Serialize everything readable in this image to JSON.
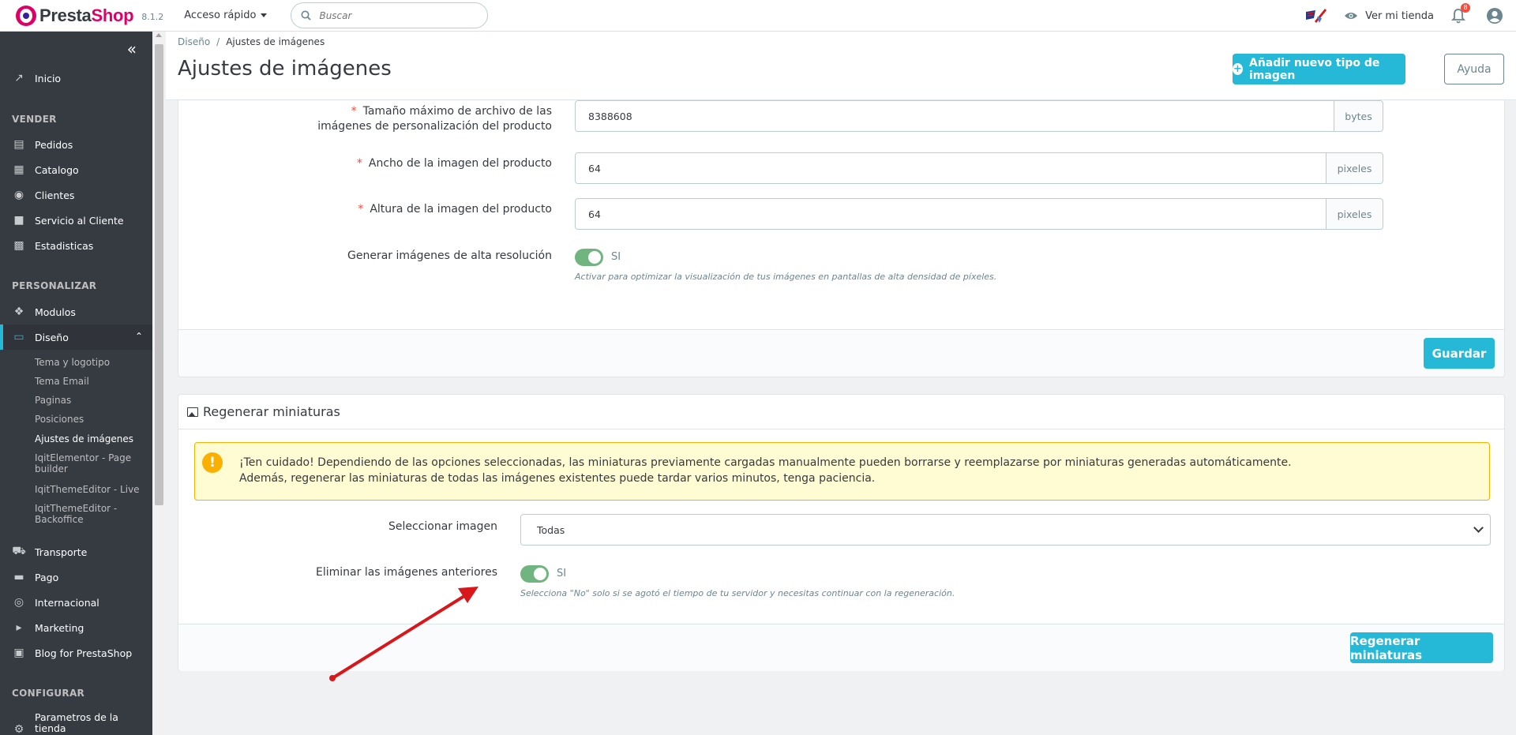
{
  "header": {
    "brand_part1": "Presta",
    "brand_part2": "Shop",
    "version": "8.1.2",
    "quick_access": "Acceso rápido",
    "search_placeholder": "Buscar",
    "view_store": "Ver mi tienda",
    "notification_count": "8"
  },
  "sidebar": {
    "collapse_glyph": "«",
    "home": "Inicio",
    "section_sell": "VENDER",
    "orders": "Pedidos",
    "catalog": "Catalogo",
    "customers": "Clientes",
    "customer_service": "Servicio al Cliente",
    "stats": "Estadisticas",
    "section_customize": "PERSONALIZAR",
    "modules": "Modulos",
    "design": "Diseño",
    "design_sub": [
      "Tema y logotipo",
      "Tema Email",
      "Paginas",
      "Posiciones",
      "Ajustes de imágenes",
      "IqitElementor - Page builder",
      "IqitThemeEditor - Live",
      "IqitThemeEditor - Backoffice"
    ],
    "shipping": "Transporte",
    "payment": "Pago",
    "international": "Internacional",
    "marketing": "Marketing",
    "blog": "Blog for PrestaShop",
    "section_configure": "CONFIGURAR",
    "shop_params": "Parametros de la tienda"
  },
  "page": {
    "breadcrumb_parent": "Diseño",
    "breadcrumb_sep": "/",
    "breadcrumb_current": "Ajustes de imágenes",
    "title": "Ajustes de imágenes",
    "add_button": "Añadir nuevo tipo de imagen",
    "help_button": "Ayuda"
  },
  "product_images_form": {
    "max_size_label": "Tamaño máximo de archivo de las imágenes de personalización del producto",
    "max_size_value": "8388608",
    "max_size_unit": "bytes",
    "width_label": "Ancho de la imagen del producto",
    "width_value": "64",
    "width_unit": "pixeles",
    "height_label": "Altura de la imagen del producto",
    "height_value": "64",
    "height_unit": "pixeles",
    "hires_label": "Generar imágenes de alta resolución",
    "hires_state": "SI",
    "hires_help": "Activar para optimizar la visualización de tus imágenes en pantallas de alta densidad de píxeles.",
    "required_mark": "*",
    "save_button": "Guardar"
  },
  "regenerate": {
    "title": "Regenerar miniaturas",
    "warning_line1": "¡Ten cuidado! Dependiendo de las opciones seleccionadas, las miniaturas previamente cargadas manualmente pueden borrarse y reemplazarse por miniaturas generadas automáticamente.",
    "warning_line2": "Además, regenerar las miniaturas de todas las imágenes existentes puede tardar varios minutos, tenga paciencia.",
    "select_label": "Seleccionar imagen",
    "select_value": "Todas",
    "erase_label": "Eliminar las imágenes anteriores",
    "erase_state": "SI",
    "erase_help": "Selecciona \"No\" solo si se agotó el tiempo de tu servidor y necesitas continuar con la regeneración.",
    "regenerate_button": "Regenerar miniaturas"
  },
  "colors": {
    "primary": "#25b9d7",
    "sidebar_bg": "#363a41",
    "brand_pink": "#df0067",
    "switch_on": "#70b580",
    "warning_bg": "#fffbd2",
    "warning_border": "#fab000",
    "annotation_arrow": "#d8171a"
  }
}
